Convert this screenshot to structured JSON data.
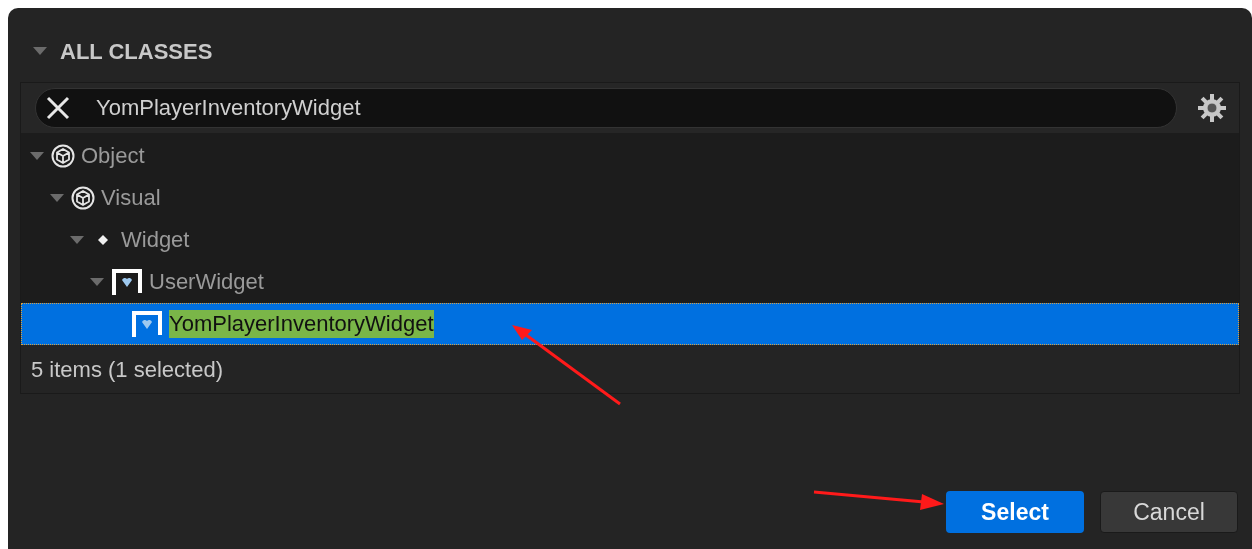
{
  "section": {
    "title": "ALL CLASSES",
    "expanded": true
  },
  "search": {
    "value": "YomPlayerInventoryWidget"
  },
  "tree": [
    {
      "label": "Object",
      "kind": "cube",
      "expanded": true,
      "selected": false,
      "matched": false,
      "children": [
        {
          "label": "Visual",
          "kind": "cube",
          "expanded": true,
          "selected": false,
          "matched": false,
          "children": [
            {
              "label": "Widget",
              "kind": "diamond",
              "expanded": true,
              "selected": false,
              "matched": false,
              "children": [
                {
                  "label": "UserWidget",
                  "kind": "widget",
                  "expanded": true,
                  "selected": false,
                  "matched": false,
                  "children": [
                    {
                      "label": "YomPlayerInventoryWidget",
                      "kind": "widget",
                      "selected": true,
                      "matched": true
                    }
                  ]
                }
              ]
            }
          ]
        }
      ]
    }
  ],
  "status": "5 items (1 selected)",
  "buttons": [
    {
      "label": "Select",
      "primary": true
    },
    {
      "label": "Cancel",
      "primary": false
    }
  ]
}
